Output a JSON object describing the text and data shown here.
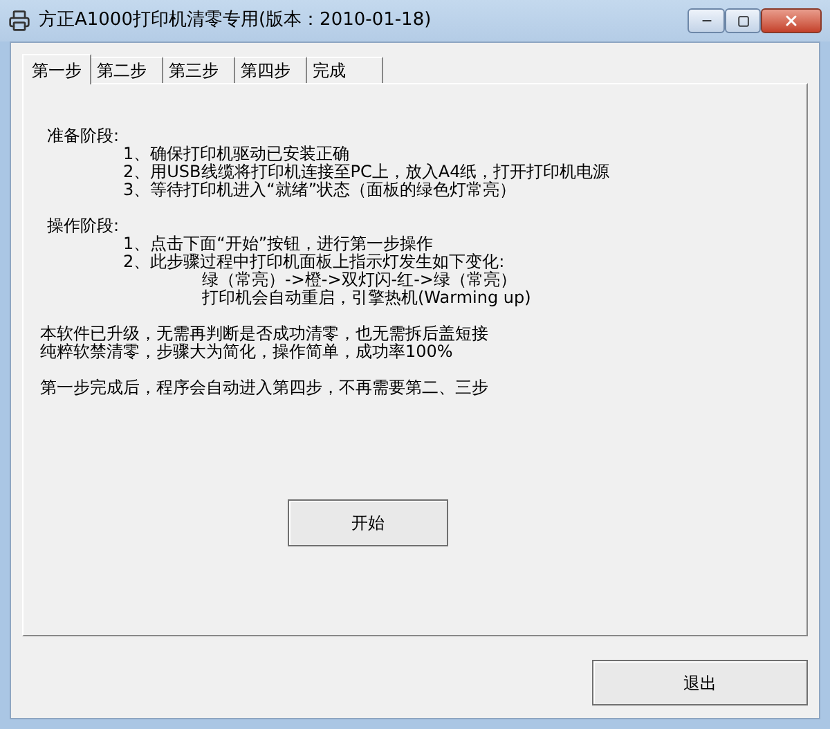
{
  "window": {
    "title": "方正A1000打印机清零专用(版本：2010-01-18)"
  },
  "tabs": [
    {
      "label": "第一步",
      "selected": true
    },
    {
      "label": "第二步",
      "selected": false
    },
    {
      "label": "第三步",
      "selected": false
    },
    {
      "label": "第四步",
      "selected": false
    },
    {
      "label": "完成",
      "selected": false
    }
  ],
  "blocks": [
    [
      {
        "kind": "heading",
        "text": "准备阶段:"
      },
      {
        "kind": "item",
        "text": "1、确保打印机驱动已安装正确"
      },
      {
        "kind": "item",
        "text": "2、用USB线缆将打印机连接至PC上，放入A4纸，打开打印机电源"
      },
      {
        "kind": "item",
        "text": "3、等待打印机进入“就绪”状态（面板的绿色灯常亮）"
      }
    ],
    [
      {
        "kind": "heading",
        "text": "操作阶段:"
      },
      {
        "kind": "item",
        "text": "1、点击下面“开始”按钮，进行第一步操作"
      },
      {
        "kind": "item",
        "text": "2、此步骤过程中打印机面板上指示灯发生如下变化:"
      },
      {
        "kind": "detail",
        "text": "绿（常亮）->橙->双灯闪-红->绿（常亮）"
      },
      {
        "kind": "detail",
        "text": "打印机会自动重启，引擎热机(Warming up)"
      }
    ],
    [
      {
        "kind": "text",
        "text": "本软件已升级，无需再判断是否成功清零，也无需拆后盖短接"
      },
      {
        "kind": "text",
        "text": "纯粹软禁清零，步骤大为简化，操作简单，成功率100%"
      }
    ],
    [
      {
        "kind": "text",
        "text": "第一步完成后，程序会自动进入第四步，不再需要第二、三步"
      }
    ]
  ],
  "start_button": "开始",
  "exit_button": "退出"
}
